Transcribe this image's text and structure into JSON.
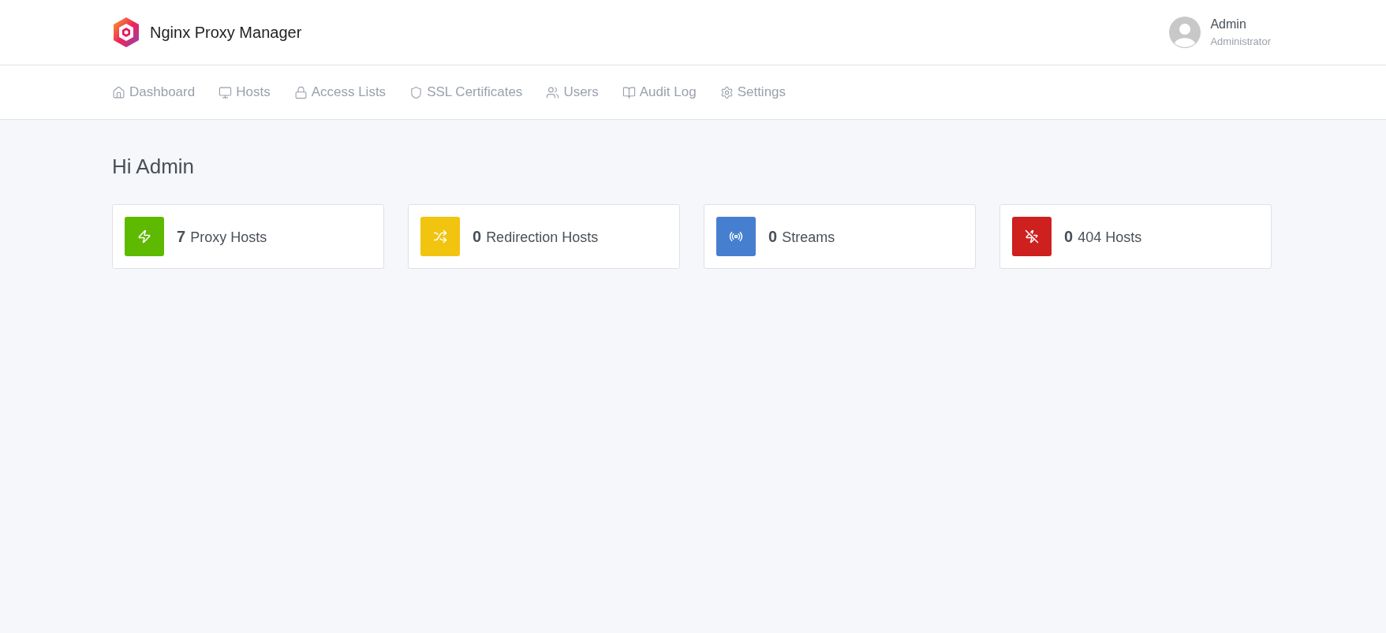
{
  "header": {
    "app_name": "Nginx Proxy Manager",
    "user": {
      "name": "Admin",
      "role": "Administrator"
    }
  },
  "nav": [
    {
      "label": "Dashboard",
      "kind": "home"
    },
    {
      "label": "Hosts",
      "kind": "monitor"
    },
    {
      "label": "Access Lists",
      "kind": "lock"
    },
    {
      "label": "SSL Certificates",
      "kind": "shield"
    },
    {
      "label": "Users",
      "kind": "users"
    },
    {
      "label": "Audit Log",
      "kind": "book"
    },
    {
      "label": "Settings",
      "kind": "settings"
    }
  ],
  "greeting": "Hi Admin",
  "stats": [
    {
      "count": "7",
      "label": "Proxy Hosts",
      "kind": "zap",
      "color": "#5eba00"
    },
    {
      "count": "0",
      "label": "Redirection Hosts",
      "kind": "shuffle",
      "color": "#f1c40f"
    },
    {
      "count": "0",
      "label": "Streams",
      "kind": "radio",
      "color": "#467fcf"
    },
    {
      "count": "0",
      "label": "404 Hosts",
      "kind": "zapoff",
      "color": "#cd201f"
    }
  ]
}
